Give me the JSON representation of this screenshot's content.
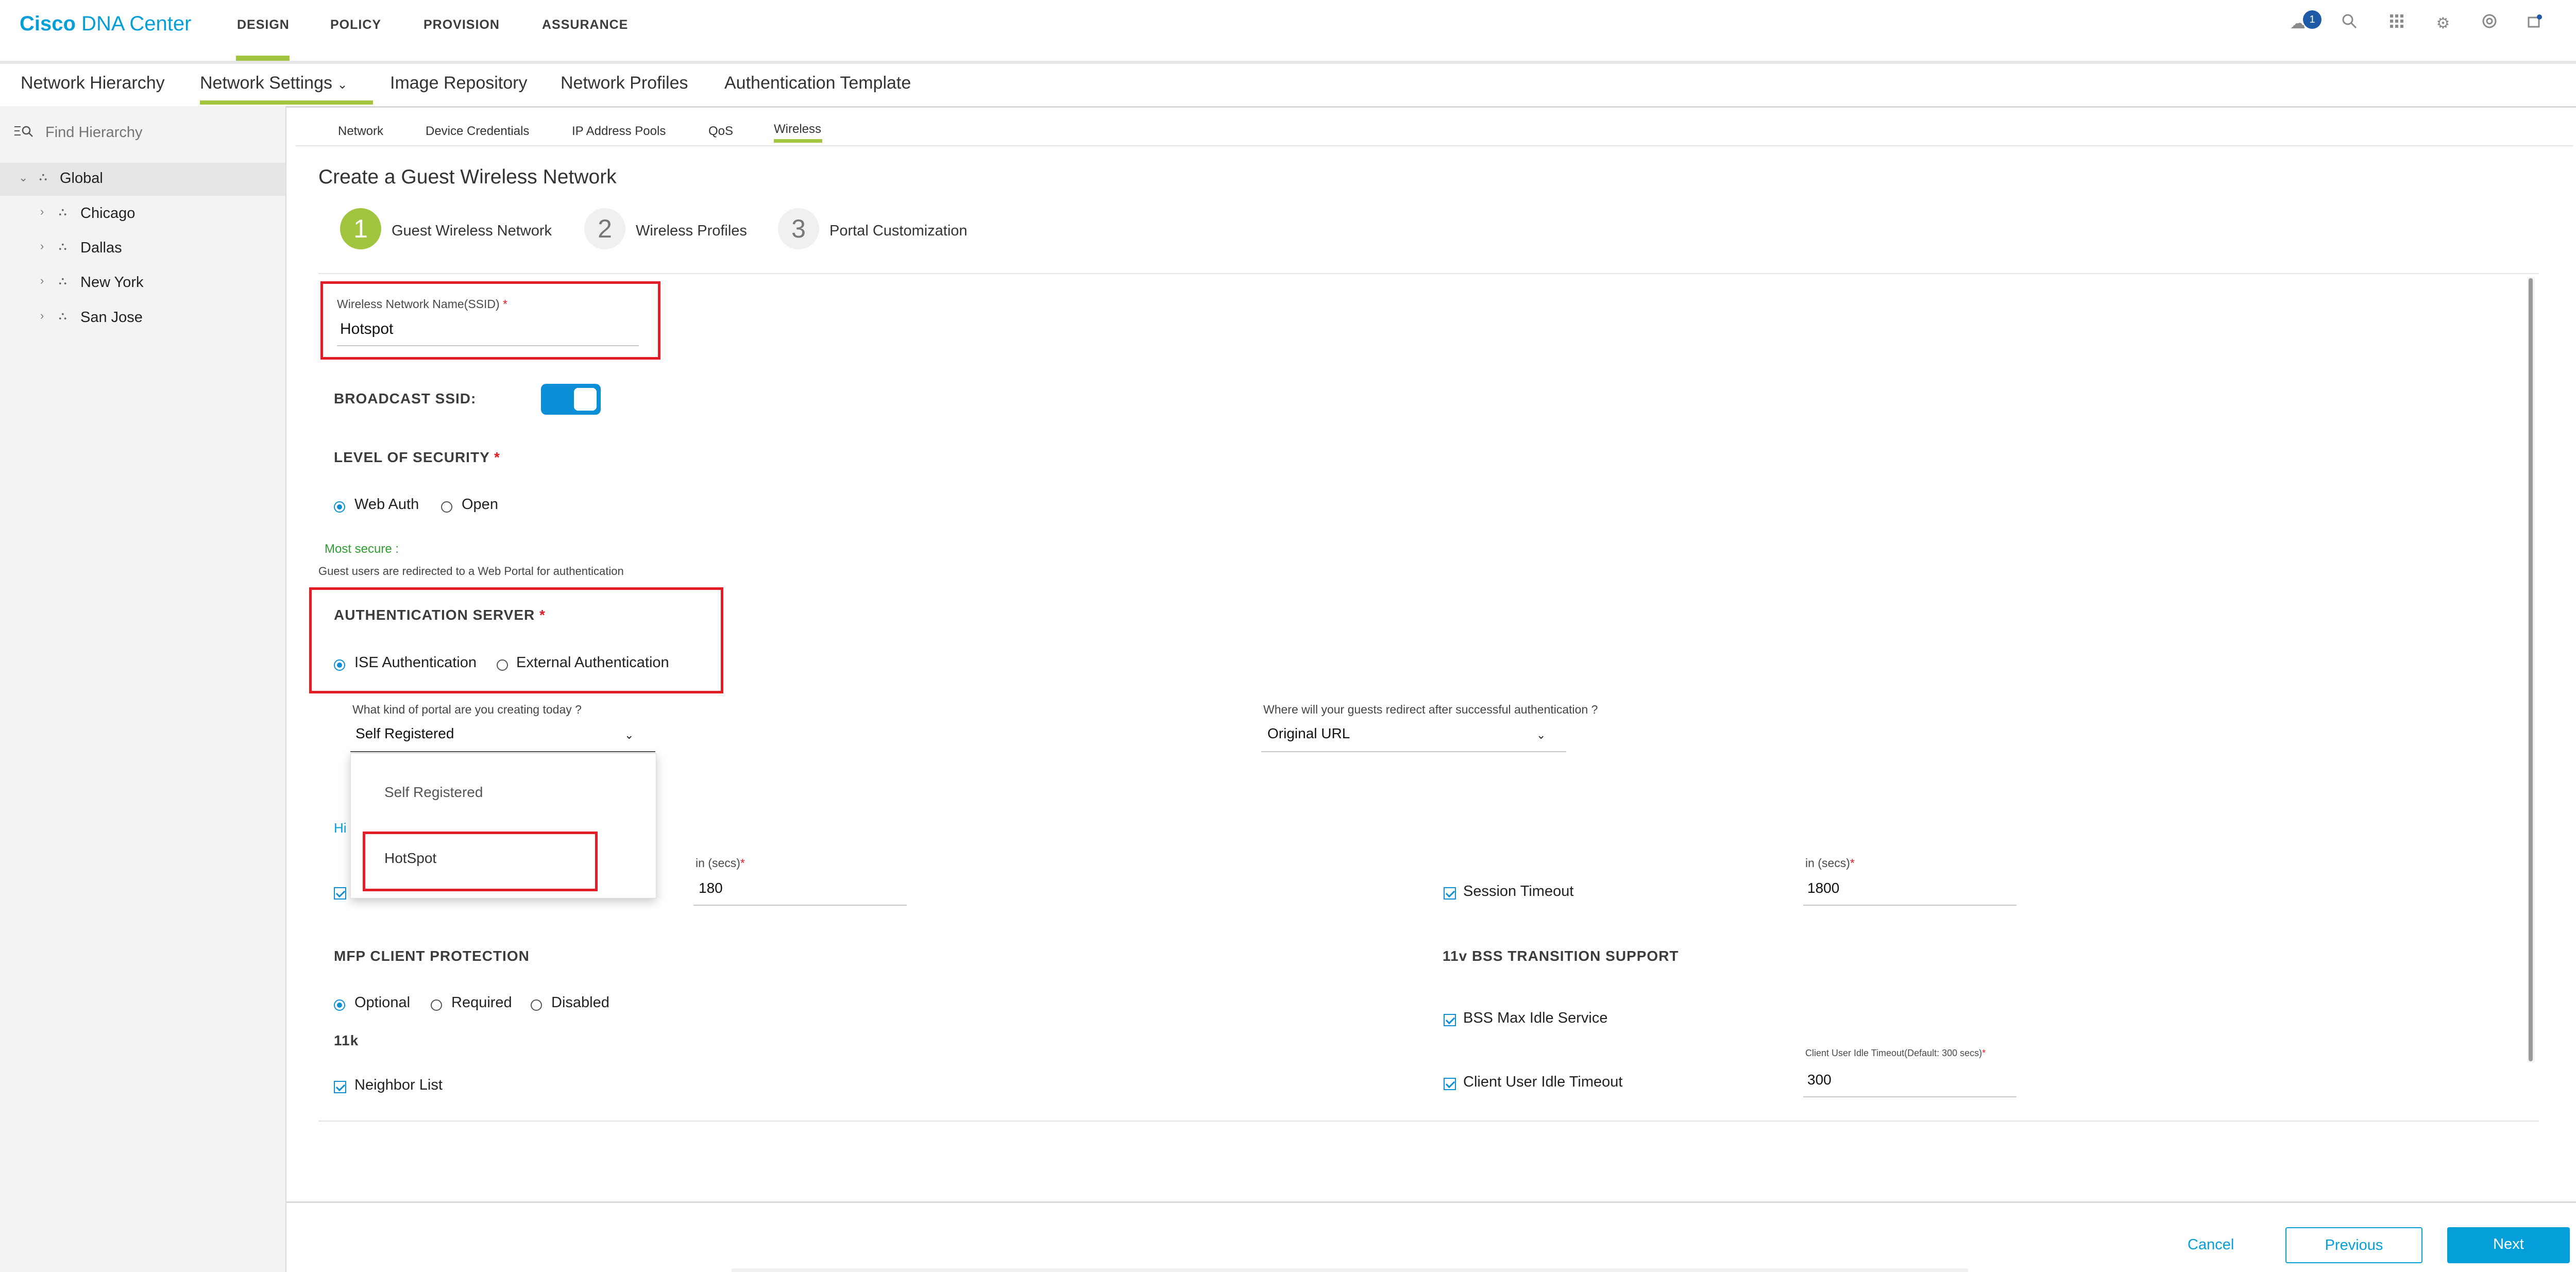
{
  "app": {
    "brand_bold": "Cisco",
    "brand_rest": " DNA Center",
    "nav": [
      "DESIGN",
      "POLICY",
      "PROVISION",
      "ASSURANCE"
    ],
    "notification_count": "1",
    "accent_color": "#a2c540",
    "link_color": "#049fd9"
  },
  "subnav": {
    "items": [
      "Network Hierarchy",
      "Network Settings",
      "Image Repository",
      "Network Profiles",
      "Authentication Template"
    ],
    "active": "Network Settings"
  },
  "sidebar": {
    "search_placeholder": "Find Hierarchy",
    "root": "Global",
    "sites": [
      "Chicago",
      "Dallas",
      "New York",
      "San Jose"
    ]
  },
  "tabs": {
    "items": [
      "Network",
      "Device Credentials",
      "IP Address Pools",
      "QoS",
      "Wireless"
    ],
    "active": "Wireless"
  },
  "page": {
    "title": "Create a Guest Wireless Network",
    "steps": [
      {
        "num": "1",
        "label": "Guest Wireless Network"
      },
      {
        "num": "2",
        "label": "Wireless Profiles"
      },
      {
        "num": "3",
        "label": "Portal Customization"
      }
    ]
  },
  "form": {
    "ssid_label": "Wireless Network Name(SSID)",
    "ssid_value": "Hotspot",
    "broadcast_label": "BROADCAST SSID:",
    "security_label": "LEVEL OF SECURITY",
    "security_options": [
      "Web Auth",
      "Open"
    ],
    "security_note": "Most secure :",
    "security_desc": "Guest users are redirected to a Web Portal for authentication",
    "auth_server_label": "AUTHENTICATION SERVER",
    "auth_options": [
      "ISE Authentication",
      "External Authentication"
    ],
    "portal_question": "What kind of portal are you creating today ?",
    "portal_value": "Self Registered",
    "portal_options": [
      "Self Registered",
      "HotSpot"
    ],
    "redirect_question": "Where will your guests redirect after successful authentication ?",
    "redirect_value": "Original URL",
    "hidden_link_fragment": "Hi",
    "secs_label_left": "in (secs)",
    "secs_value_left": "180",
    "session_timeout_label": "Session Timeout",
    "secs_label_right": "in (secs)",
    "secs_value_right": "1800",
    "mfp_label": "MFP CLIENT PROTECTION",
    "mfp_options": [
      "Optional",
      "Required",
      "Disabled"
    ],
    "k11_label": "11k",
    "neighbor_label": "Neighbor List",
    "bss_label": "11v BSS TRANSITION SUPPORT",
    "bss_max_label": "BSS Max Idle Service",
    "idle_timeout_hint": "Client User Idle Timeout(Default: 300 secs)",
    "client_idle_label": "Client User Idle Timeout",
    "client_idle_value": "300"
  },
  "footer": {
    "cancel": "Cancel",
    "previous": "Previous",
    "next": "Next"
  }
}
